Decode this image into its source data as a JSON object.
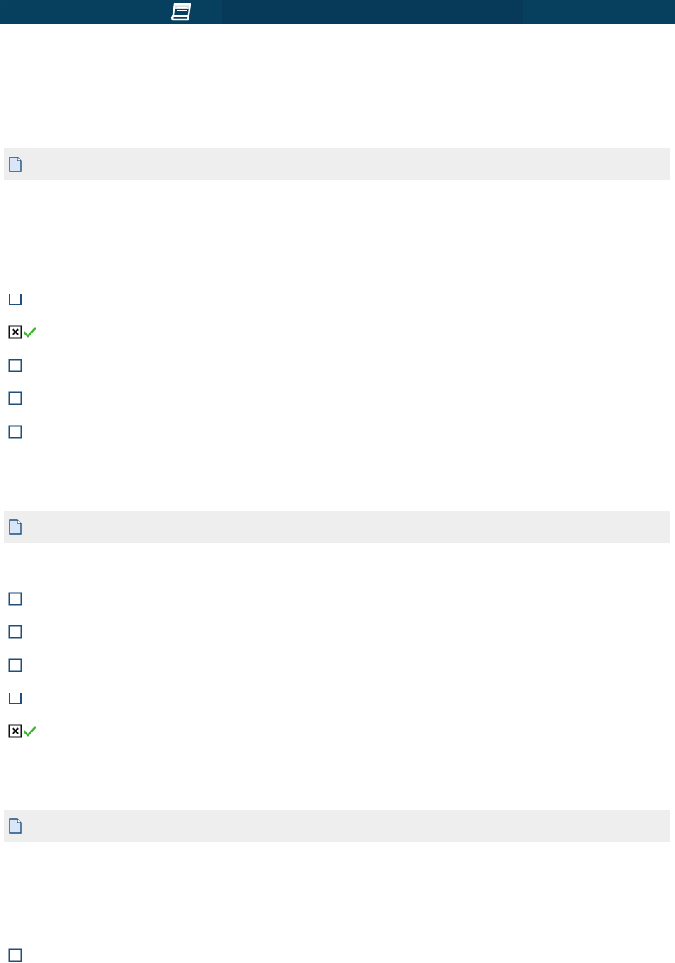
{
  "header": {
    "icon": "book-icon",
    "colors": {
      "bar": "#08405f",
      "bar_mid": "#073a58"
    }
  },
  "sections": [
    {
      "icon": "document-icon",
      "options": [
        {
          "state": "unchecked-partial",
          "correct": false
        },
        {
          "state": "checked",
          "correct": true
        },
        {
          "state": "unchecked",
          "correct": false
        },
        {
          "state": "unchecked",
          "correct": false
        },
        {
          "state": "unchecked",
          "correct": false
        }
      ]
    },
    {
      "icon": "document-icon",
      "options": [
        {
          "state": "unchecked",
          "correct": false
        },
        {
          "state": "unchecked",
          "correct": false
        },
        {
          "state": "unchecked",
          "correct": false
        },
        {
          "state": "unchecked-partial",
          "correct": false
        },
        {
          "state": "checked",
          "correct": true
        }
      ]
    },
    {
      "icon": "document-icon",
      "options": [
        {
          "state": "unchecked",
          "correct": false
        }
      ]
    }
  ],
  "colors": {
    "section_header_bg": "#eeeeee",
    "checkbox_border": "#1f4f7a",
    "correct_mark": "#3bb82a"
  }
}
